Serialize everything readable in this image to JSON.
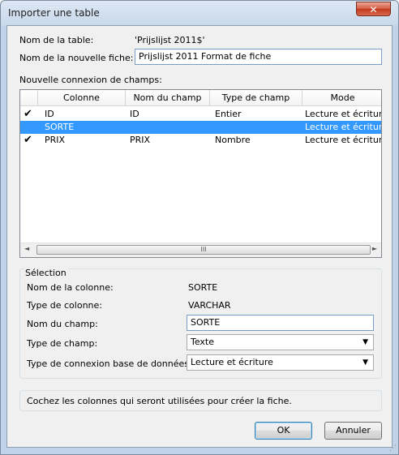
{
  "window": {
    "title": "Importer une table",
    "close_glyph": "✕"
  },
  "table_name": {
    "label": "Nom de la table:",
    "value": "'Prijslijst 2011$'"
  },
  "new_form": {
    "label": "Nom de la nouvelle fiche:",
    "value": "Prijslijst 2011   Format de fiche"
  },
  "mapping": {
    "label": "Nouvelle connexion de champs:",
    "headers": [
      "Colonne",
      "Nom du champ",
      "Type de champ",
      "Mode"
    ],
    "rows": [
      {
        "checked": true,
        "selected": false,
        "column": "ID",
        "field": "ID",
        "type": "Entier",
        "mode": "Lecture et écriture"
      },
      {
        "checked": false,
        "selected": true,
        "column": "SORTE",
        "field": "",
        "type": "",
        "mode": "Lecture et écriture"
      },
      {
        "checked": true,
        "selected": false,
        "column": "PRIX",
        "field": "PRIX",
        "type": "Nombre",
        "mode": "Lecture et écriture"
      }
    ],
    "check_glyph": "✔",
    "scroll_left": "◄",
    "scroll_right": "►",
    "thumb_grip": "III"
  },
  "selection": {
    "title": "Sélection",
    "column_name_label": "Nom de la colonne:",
    "column_name_value": "SORTE",
    "column_type_label": "Type de colonne:",
    "column_type_value": "VARCHAR",
    "field_name_label": "Nom du champ:",
    "field_name_value": "SORTE",
    "field_type_label": "Type de champ:",
    "field_type_value": "Texte",
    "db_link_label": "Type de connexion base de données:",
    "db_link_value": "Lecture et écriture",
    "caret_glyph": "▼"
  },
  "hint": "Cochez les colonnes qui seront utilisées pour créer la fiche.",
  "buttons": {
    "ok": "OK",
    "cancel": "Annuler"
  },
  "resize_glyph": "⋰",
  "colors": {
    "selection": "#3399ff",
    "close": "#c23a1f"
  }
}
